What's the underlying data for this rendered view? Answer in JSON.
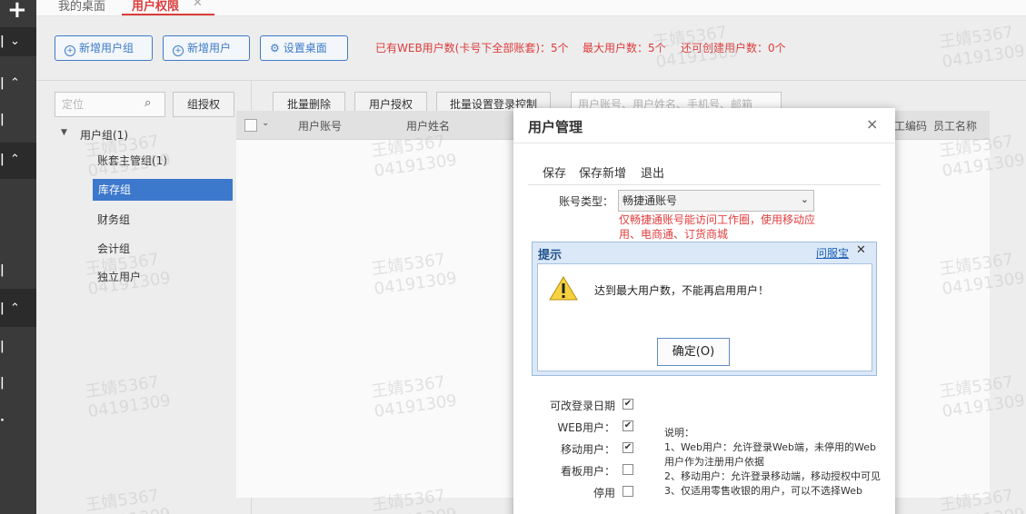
{
  "tabs": {
    "desktop": "我的桌面",
    "active": "用户权限",
    "close_glyph": "✕"
  },
  "toolbar": {
    "add_group": "新增用户组",
    "add_user": "新增用户",
    "set_desktop": "设置桌面"
  },
  "stats": {
    "web_users": "已有WEB用户数(卡号下全部账套)：5个",
    "max_users": "最大用户数：5个",
    "can_create": "还可创建用户数：0个"
  },
  "left_panel": {
    "search_placeholder": "定位",
    "group_auth": "组授权",
    "tree_root": "用户组(1)",
    "tree_items": [
      "账套主管组(1)",
      "库存组",
      "财务组",
      "会计组",
      "独立用户"
    ]
  },
  "right_toolbar": {
    "batch_delete": "批量删除",
    "user_auth": "用户授权",
    "batch_login": "批量设置登录控制",
    "search_placeholder": "用户账号、用户姓名、手机号、邮箱"
  },
  "grid": {
    "columns": [
      "用户账号",
      "用户姓名",
      "工编码",
      "员工名称"
    ]
  },
  "watermark": {
    "name": "王婧5367",
    "code": "04191309"
  },
  "dialog": {
    "title": "用户管理",
    "close_glyph": "×",
    "actions": [
      "保存",
      "保存新增",
      "退出"
    ],
    "account_type_label": "账号类型：",
    "account_type_value": "畅捷通账号",
    "account_warning": "仅畅捷通账号能访问工作圈，使用移动应用、电商通、订货商城",
    "checks": [
      {
        "label": "可改登录日期",
        "checked": true
      },
      {
        "label": "WEB用户：",
        "checked": true
      },
      {
        "label": "移动用户：",
        "checked": true
      },
      {
        "label": "看板用户：",
        "checked": false
      },
      {
        "label": "停用",
        "checked": false
      }
    ],
    "note_title": "说明：",
    "note_1": "1、Web用户：允许登录Web端，未停用的Web用户作为注册用户依据",
    "note_2": "2、移动用户：允许登录移动端，移动授权中可见",
    "note_3": "3、仅适用零售收银的用户，可以不选择Web"
  },
  "alert": {
    "title": "提示",
    "link": "问服宝",
    "close_glyph": "✕",
    "message": "达到最大用户数，不能再启用用户！",
    "ok": "确定(O)",
    "icon": "warning-icon"
  },
  "colors": {
    "accent_red": "#e23d3d",
    "accent_blue": "#3f7fcc",
    "selected_row": "#3e7bd1"
  }
}
